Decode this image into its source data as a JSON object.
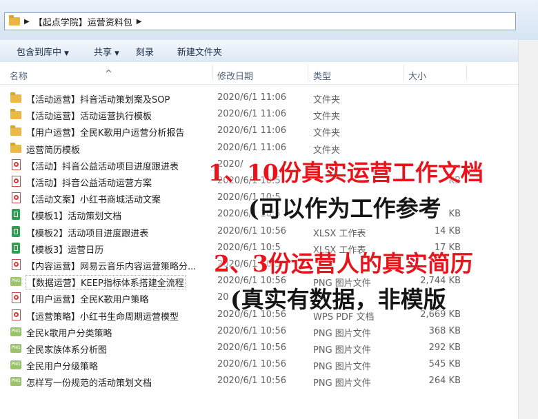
{
  "breadcrumb": {
    "path": "【起点学院】运营资料包"
  },
  "toolbar": {
    "include_library": "包含到库中",
    "share": "共享",
    "burn": "刻录",
    "new_folder": "新建文件夹"
  },
  "columns": {
    "name": "名称",
    "date": "修改日期",
    "type": "类型",
    "size": "大小"
  },
  "files": [
    {
      "icon": "folder",
      "name": "【活动运营】抖音活动策划案及SOP",
      "date": "2020/6/1 11:06",
      "type": "文件夹",
      "size": ""
    },
    {
      "icon": "folder",
      "name": "【活动运营】活动运营执行模板",
      "date": "2020/6/1 11:06",
      "type": "文件夹",
      "size": ""
    },
    {
      "icon": "folder",
      "name": "【用户运营】全民K歌用户运营分析报告",
      "date": "2020/6/1 11:06",
      "type": "文件夹",
      "size": ""
    },
    {
      "icon": "folder",
      "name": "运营简历模板",
      "date": "2020/6/1 11:06",
      "type": "文件夹",
      "size": ""
    },
    {
      "icon": "pdf",
      "name": "【活动】抖音公益活动项目进度跟进表",
      "date": "2020/",
      "type": "",
      "size": ""
    },
    {
      "icon": "pdf",
      "name": "【活动】抖音公益活动运营方案",
      "date": "2020/6/1 10:5",
      "type": "",
      "size": "KB"
    },
    {
      "icon": "pdf",
      "name": "【活动文案】小红书商城活动文案",
      "date": "2020/6/1 10:5",
      "type": "",
      "size": ""
    },
    {
      "icon": "xlsx",
      "name": "【模板1】活动策划文档",
      "date": "2020/6/1 10:5",
      "type": "",
      "size": "KB"
    },
    {
      "icon": "xlsx",
      "name": "【模板2】活动项目进度跟进表",
      "date": "2020/6/1 10:56",
      "type": "XLSX 工作表",
      "size": "14 KB"
    },
    {
      "icon": "xlsx",
      "name": "【模板3】运营日历",
      "date": "2020/6/1 10:5",
      "type": "XLSX 工作表",
      "size": "17 KB"
    },
    {
      "icon": "pdf",
      "name": "【内容运营】网易云音乐内容运营策略分...",
      "date": "2020/6/1 10:5",
      "type": "",
      "size": ""
    },
    {
      "icon": "png",
      "name": "【数据运营】KEEP指标体系搭建全流程",
      "date": "2020/6/1 10:56",
      "type": "PNG 图片文件",
      "size": "2,744 KB"
    },
    {
      "icon": "pdf",
      "name": "【用户运营】全民K歌用户策略",
      "date": "20",
      "type": "",
      "size": ""
    },
    {
      "icon": "pdf",
      "name": "【运营策略】小红书生命周期运营模型",
      "date": "2020/6/1 10:56",
      "type": "WPS PDF 文档",
      "size": "2,669 KB"
    },
    {
      "icon": "png",
      "name": "全民k歌用户分类策略",
      "date": "2020/6/1 10:56",
      "type": "PNG 图片文件",
      "size": "368 KB"
    },
    {
      "icon": "png",
      "name": "全民家族体系分析图",
      "date": "2020/6/1 10:56",
      "type": "PNG 图片文件",
      "size": "292 KB"
    },
    {
      "icon": "png",
      "name": "全民用户分级策略",
      "date": "2020/6/1 10:56",
      "type": "PNG 图片文件",
      "size": "545 KB"
    },
    {
      "icon": "png",
      "name": "怎样写一份规范的活动策划文档",
      "date": "2020/6/1 10:56",
      "type": "PNG 图片文件",
      "size": "264 KB"
    }
  ],
  "overlay": {
    "line1": "1、10份真实运营工作文档",
    "line2": "(可以作为工作参考",
    "line3": "2、3份运营人的真实简历",
    "line4": "(真实有数据，非模版"
  }
}
